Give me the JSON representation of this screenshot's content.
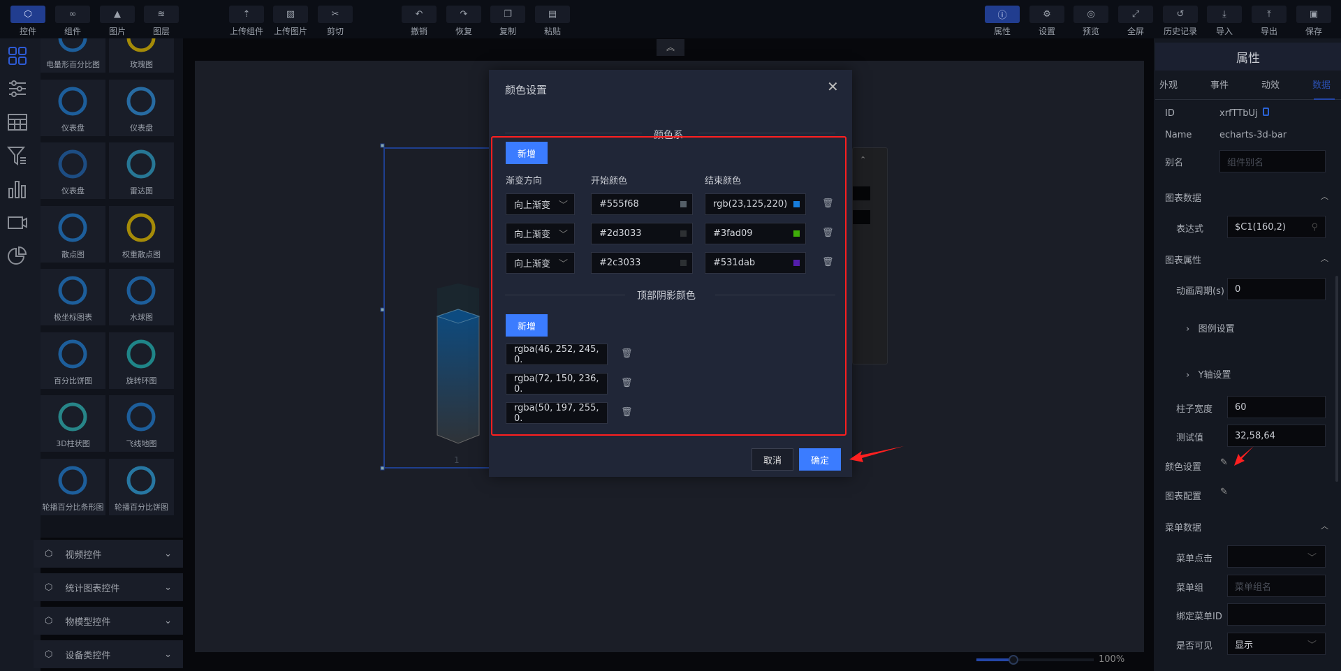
{
  "toolbar": {
    "left": [
      {
        "label": "控件",
        "icon": "cube-icon",
        "active": true
      },
      {
        "label": "组件",
        "icon": "link-icon"
      },
      {
        "label": "图片",
        "icon": "image-icon"
      },
      {
        "label": "图层",
        "icon": "layers-icon"
      },
      {
        "label": "上传组件",
        "icon": "upload-component-icon"
      },
      {
        "label": "上传图片",
        "icon": "upload-image-icon"
      },
      {
        "label": "剪切",
        "icon": "cut-icon"
      },
      {
        "label": "撤销",
        "icon": "undo-icon"
      },
      {
        "label": "恢复",
        "icon": "redo-icon"
      },
      {
        "label": "复制",
        "icon": "copy-icon"
      },
      {
        "label": "粘贴",
        "icon": "paste-icon"
      }
    ],
    "right": [
      {
        "label": "属性",
        "icon": "info-icon",
        "active": true
      },
      {
        "label": "设置",
        "icon": "gear-icon"
      },
      {
        "label": "预览",
        "icon": "preview-icon"
      },
      {
        "label": "全屏",
        "icon": "fullscreen-icon"
      },
      {
        "label": "历史记录",
        "icon": "history-icon"
      },
      {
        "label": "导入",
        "icon": "import-icon"
      },
      {
        "label": "导出",
        "icon": "export-icon"
      },
      {
        "label": "保存",
        "icon": "save-icon"
      }
    ]
  },
  "components": [
    "电量形百分比图",
    "玫瑰图",
    "仪表盘",
    "仪表盘",
    "仪表盘",
    "雷达图",
    "散点图",
    "权重散点图",
    "极坐标图表",
    "水球图",
    "百分比饼图",
    "旋转环图",
    "3D柱状图",
    "飞线地图",
    "轮播百分比条形图",
    "轮播百分比饼图"
  ],
  "accordion": [
    "视频控件",
    "统计图表控件",
    "物模型控件",
    "设备类控件"
  ],
  "canvas": {
    "bar_label": "1",
    "zoom": "100%",
    "zoom_fraction": 0.3
  },
  "dialog": {
    "title": "颜色设置",
    "section1": "颜色系",
    "add": "新增",
    "col_dir": "渐变方向",
    "col_start": "开始颜色",
    "col_end": "结束颜色",
    "rows": [
      {
        "dir": "向上渐变",
        "start": "#555f68",
        "start_color": "#555f68",
        "end": "rgb(23,125,220)",
        "end_color": "#177ddc"
      },
      {
        "dir": "向上渐变",
        "start": "#2d3033",
        "start_color": "#2d3033",
        "end": "#3fad09",
        "end_color": "#3fad09"
      },
      {
        "dir": "向上渐变",
        "start": "#2c3033",
        "start_color": "#2c3033",
        "end": "#531dab",
        "end_color": "#531dab"
      }
    ],
    "section2": "顶部阴影颜色",
    "shadows": [
      "rgba(46, 252, 245, 0.",
      "rgba(72, 150, 236, 0.",
      "rgba(50, 197, 255, 0."
    ],
    "cancel": "取消",
    "confirm": "确定"
  },
  "props": {
    "title": "属性",
    "tabs": [
      "外观",
      "事件",
      "动效",
      "数据"
    ],
    "id_label": "ID",
    "id": "xrfTTbUj",
    "name_label": "Name",
    "name": "echarts-3d-bar",
    "alias_label": "别名",
    "alias_ph": "组件别名",
    "chart_data": "图表数据",
    "expr_label": "表达式",
    "expr": "$C1(160,2)",
    "chart_props": "图表属性",
    "anim_label": "动画周期(s)",
    "anim": "0",
    "legend": "图例设置",
    "yaxis": "Y轴设置",
    "width_label": "柱子宽度",
    "width": "60",
    "test_label": "测试值",
    "test": "32,58,64",
    "color_label": "颜色设置",
    "config_label": "图表配置",
    "menu_data": "菜单数据",
    "menu_click": "菜单点击",
    "menu_group": "菜单组",
    "menu_group_ph": "菜单组名",
    "menu_id": "绑定菜单ID",
    "visible_label": "是否可见",
    "visible": "显示"
  }
}
